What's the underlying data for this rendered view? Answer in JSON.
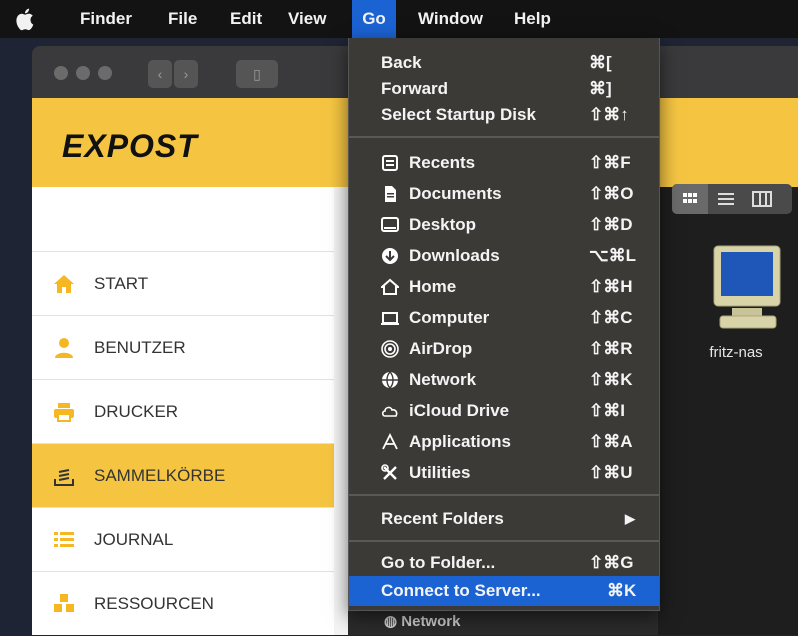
{
  "menubar": {
    "items": [
      "Finder",
      "File",
      "Edit",
      "View",
      "Go",
      "Window",
      "Help"
    ]
  },
  "app": {
    "logo": "EΧPOST",
    "nav": [
      {
        "label": "START",
        "icon": "home-icon"
      },
      {
        "label": "BENUTZER",
        "icon": "user-icon"
      },
      {
        "label": "DRUCKER",
        "icon": "printer-icon"
      },
      {
        "label": "SAMMELKÖRBE",
        "icon": "inbox-tray-icon"
      },
      {
        "label": "JOURNAL",
        "icon": "list-icon"
      },
      {
        "label": "RESSOURCEN",
        "icon": "cubes-icon"
      }
    ],
    "active_nav": "SAMMELKÖRBE",
    "accent_color": "#f5c542"
  },
  "finder": {
    "device_label": "fritz-nas",
    "behind_sidebar_item": "Network"
  },
  "go_menu": {
    "top": [
      {
        "label": "Back",
        "shortcut": "⌘["
      },
      {
        "label": "Forward",
        "shortcut": "⌘]"
      },
      {
        "label": "Select Startup Disk",
        "shortcut": "⇧⌘↑"
      }
    ],
    "places": [
      {
        "label": "Recents",
        "shortcut": "⇧⌘F",
        "icon": "recents-icon"
      },
      {
        "label": "Documents",
        "shortcut": "⇧⌘O",
        "icon": "documents-icon"
      },
      {
        "label": "Desktop",
        "shortcut": "⇧⌘D",
        "icon": "desktop-icon"
      },
      {
        "label": "Downloads",
        "shortcut": "⌥⌘L",
        "icon": "downloads-icon"
      },
      {
        "label": "Home",
        "shortcut": "⇧⌘H",
        "icon": "home-icon"
      },
      {
        "label": "Computer",
        "shortcut": "⇧⌘C",
        "icon": "computer-icon"
      },
      {
        "label": "AirDrop",
        "shortcut": "⇧⌘R",
        "icon": "airdrop-icon"
      },
      {
        "label": "Network",
        "shortcut": "⇧⌘K",
        "icon": "network-icon"
      },
      {
        "label": "iCloud Drive",
        "shortcut": "⇧⌘I",
        "icon": "icloud-icon"
      },
      {
        "label": "Applications",
        "shortcut": "⇧⌘A",
        "icon": "applications-icon"
      },
      {
        "label": "Utilities",
        "shortcut": "⇧⌘U",
        "icon": "utilities-icon"
      }
    ],
    "recent_folders": {
      "label": "Recent Folders",
      "arrow": "▶"
    },
    "bottom": [
      {
        "label": "Go to Folder...",
        "shortcut": "⇧⌘G"
      },
      {
        "label": "Connect to Server...",
        "shortcut": "⌘K"
      }
    ],
    "highlighted": "Connect to Server...",
    "highlight_color": "#1b62d3"
  }
}
